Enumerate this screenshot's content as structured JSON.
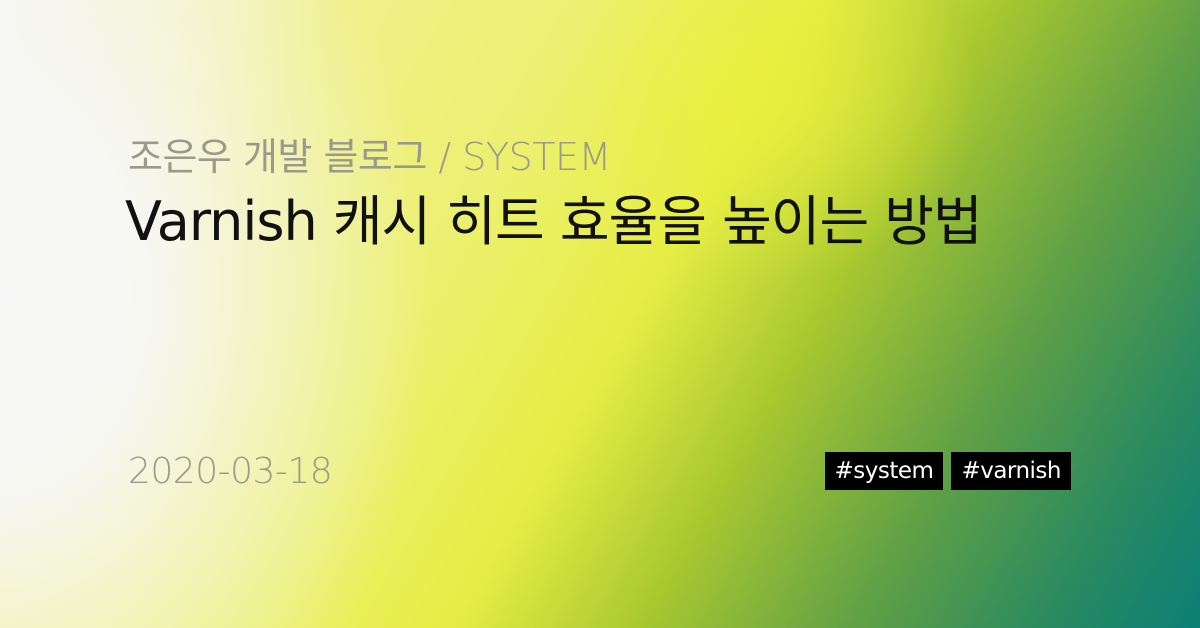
{
  "category": "조은우 개발 블로그 / SYSTEM",
  "title": "Varnish 캐시 히트 효율을 높이는 방법",
  "date": "2020-03-18",
  "tags": [
    "#system",
    "#varnish"
  ],
  "colors": {
    "gradient_light": "#f7f7f7",
    "gradient_yellow": "#e6ee44",
    "gradient_green": "#5fa046",
    "gradient_teal": "#0b7f76",
    "tag_background": "#000000",
    "title_text": "#111111",
    "meta_text": "#9a9a8a"
  }
}
